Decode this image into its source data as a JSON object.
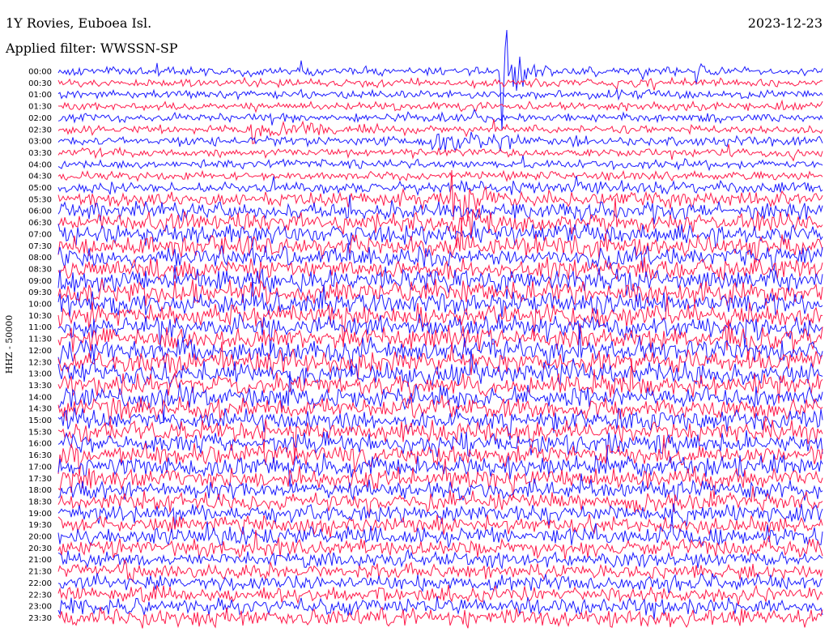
{
  "header": {
    "station_title": "1Y Rovies, Euboea Isl.",
    "date": "2023-12-23",
    "filter": "Applied filter: WWSSN-SP"
  },
  "chart_data": {
    "type": "helicorder",
    "title": "1Y Rovies, Euboea Isl.",
    "subtitle": "Applied filter: WWSSN-SP",
    "date": "2023-12-23",
    "ylabel": "HHZ - 50000",
    "colors": [
      "#1a1aff",
      "#ff1a4a"
    ],
    "row_times": [
      "00:00",
      "00:30",
      "01:00",
      "01:30",
      "02:00",
      "02:30",
      "03:00",
      "03:30",
      "04:00",
      "04:30",
      "05:00",
      "05:30",
      "06:00",
      "06:30",
      "07:00",
      "07:30",
      "08:00",
      "08:30",
      "09:00",
      "09:30",
      "10:00",
      "10:30",
      "11:00",
      "11:30",
      "12:00",
      "12:30",
      "13:00",
      "13:30",
      "14:00",
      "14:30",
      "15:00",
      "15:30",
      "16:00",
      "16:30",
      "17:00",
      "17:30",
      "18:00",
      "18:30",
      "19:00",
      "19:30",
      "20:00",
      "20:30",
      "21:00",
      "21:30",
      "22:00",
      "22:30",
      "23:00",
      "23:30"
    ],
    "trace_amplitude": [
      0.5,
      0.5,
      0.5,
      0.5,
      0.5,
      0.5,
      0.5,
      0.5,
      0.5,
      0.5,
      0.7,
      0.9,
      1.0,
      1.1,
      1.2,
      1.2,
      1.2,
      1.2,
      1.3,
      1.3,
      1.3,
      1.3,
      1.3,
      1.3,
      1.3,
      1.3,
      1.3,
      1.3,
      1.3,
      1.2,
      1.2,
      1.2,
      1.2,
      1.2,
      1.2,
      1.2,
      1.1,
      1.1,
      1.0,
      1.0,
      1.0,
      1.0,
      0.9,
      0.9,
      0.9,
      0.9,
      0.9,
      1.0
    ],
    "events": [
      {
        "time": "00:00",
        "offset_min": 17.3,
        "amplitude": 8,
        "duration_min": 0.5
      },
      {
        "time": "00:00",
        "offset_min": 25.0,
        "amplitude": 3,
        "duration_min": 0.2
      },
      {
        "time": "02:30",
        "offset_min": 7.5,
        "amplitude": 1.5,
        "duration_min": 2
      },
      {
        "time": "03:00",
        "offset_min": 14.5,
        "amplitude": 1.5,
        "duration_min": 3
      },
      {
        "time": "05:30",
        "offset_min": 15.4,
        "amplitude": 3,
        "duration_min": 1
      },
      {
        "time": "06:30",
        "offset_min": 15.5,
        "amplitude": 2.5,
        "duration_min": 1
      }
    ]
  }
}
